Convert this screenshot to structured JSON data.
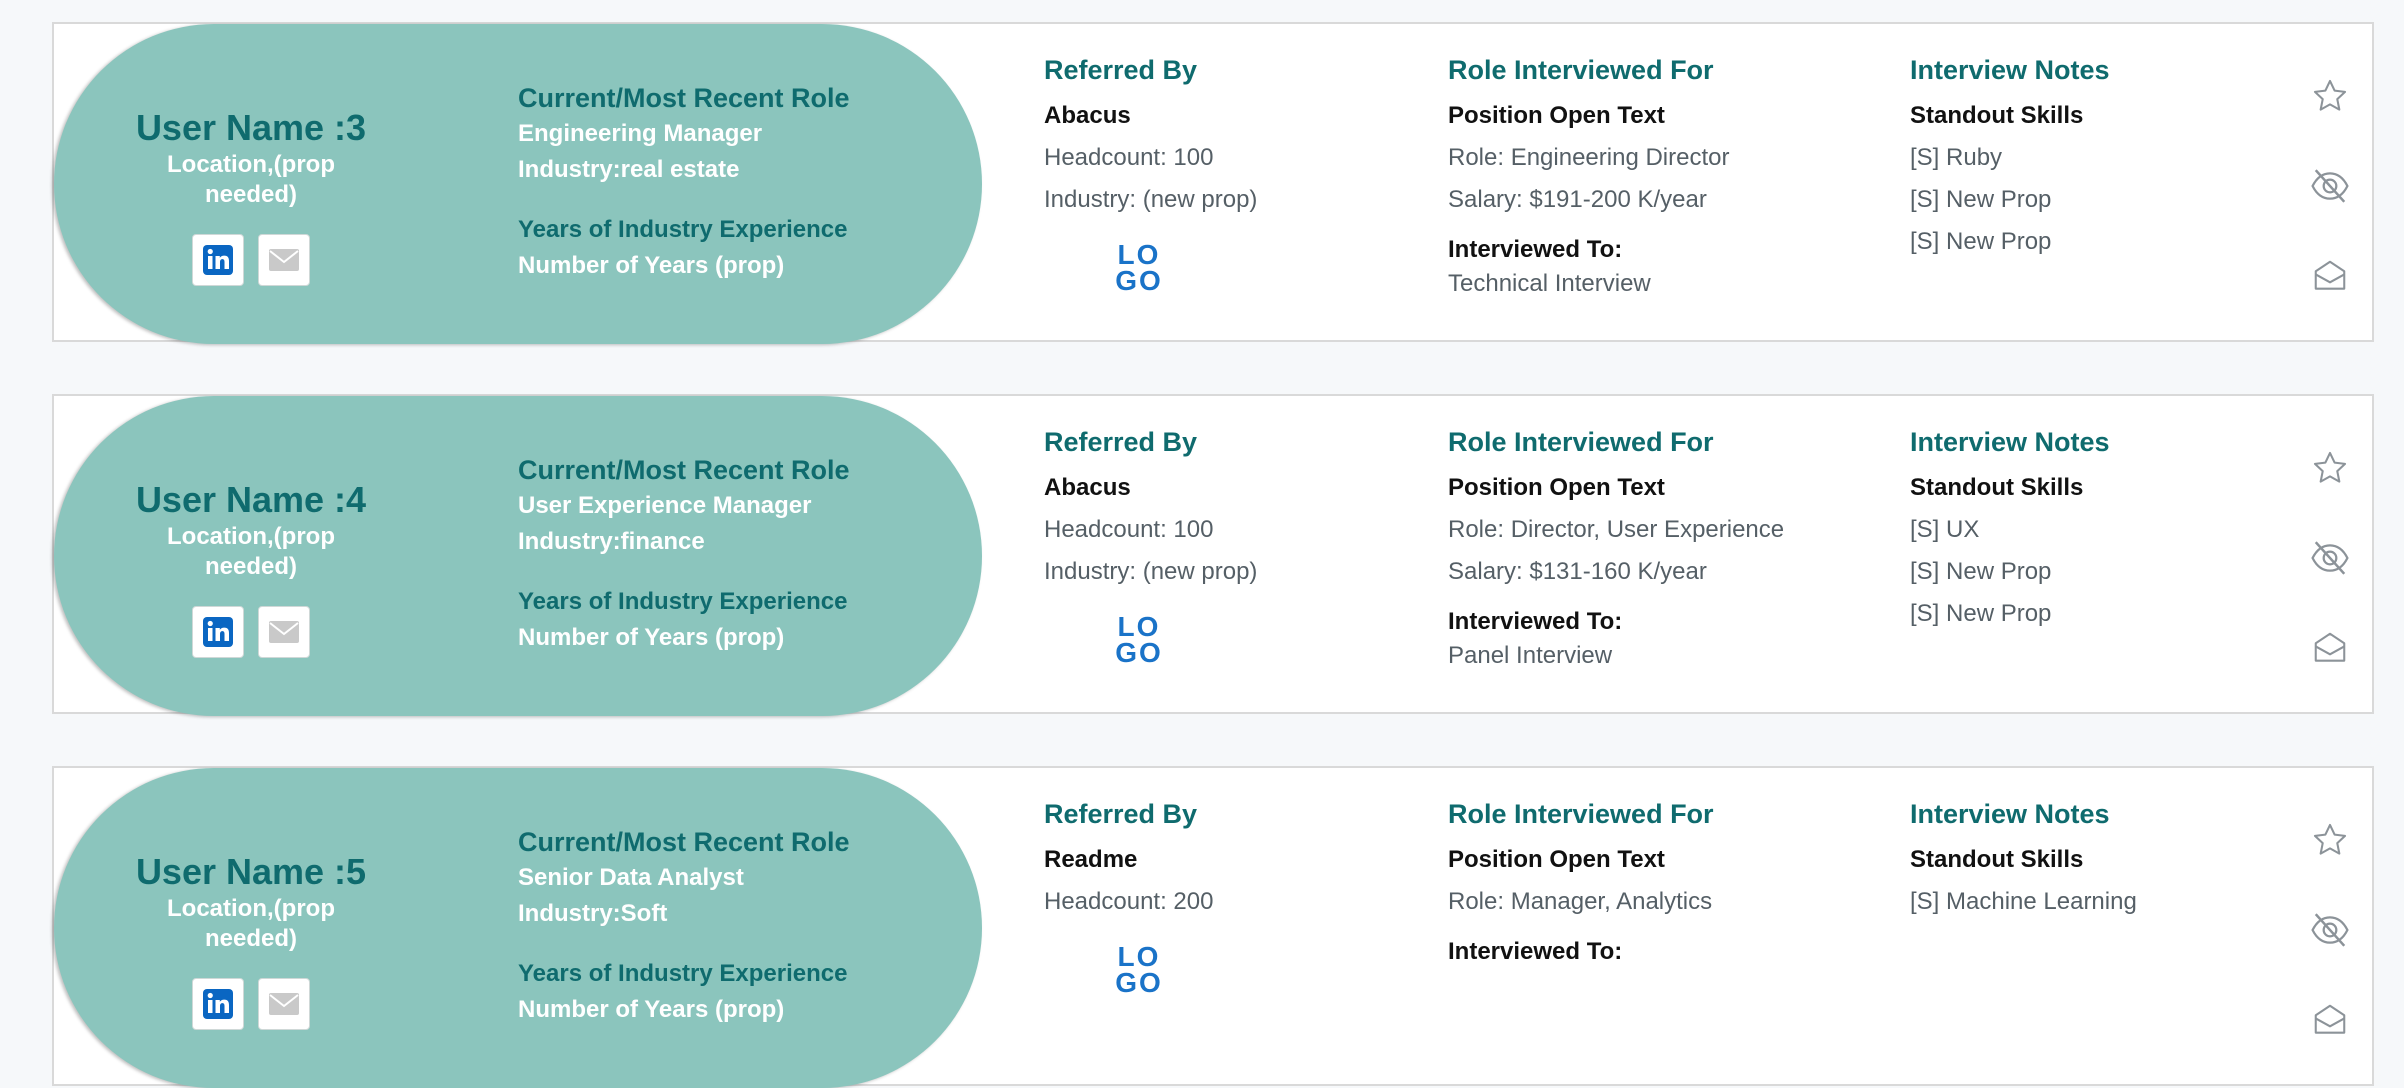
{
  "labels": {
    "current_role": "Current/Most Recent Role",
    "years_heading": "Years of Industry Experience",
    "years_value": "Number of Years (prop)",
    "referred_by": "Referred By",
    "role_interviewed_for": "Role Interviewed For",
    "interviewed_to": "Interviewed To:",
    "interview_notes": "Interview Notes",
    "standout_skills": "Standout Skills",
    "location": "Location,(prop needed)",
    "logo_text_top": "LO",
    "logo_text_bottom": "GO"
  },
  "icons": {
    "linkedin": "linkedin-icon",
    "email": "mail-icon",
    "favorite": "star-icon",
    "hide": "eye-off-icon",
    "archive": "inbox-icon"
  },
  "colors": {
    "accent_teal": "#0f6b6e",
    "pill_bg": "#8bc5bd",
    "logo_blue": "#1a73c8",
    "linkedin_blue": "#0a66c2"
  },
  "candidates": [
    {
      "user_name": "User Name :3",
      "title": "Engineering Manager",
      "industry": "Industry:real estate",
      "referrer": "Abacus",
      "headcount": "Headcount: 100",
      "ref_industry": "Industry: (new prop)",
      "position": "Position Open Text",
      "role": "Role: Engineering Director",
      "salary": "Salary: $191-200 K/year",
      "interview_type": "Technical Interview",
      "skills": [
        "[S] Ruby",
        "[S] New Prop",
        "[S] New Prop"
      ]
    },
    {
      "user_name": "User Name :4",
      "title": "User Experience Manager",
      "industry": "Industry:finance",
      "referrer": "Abacus",
      "headcount": "Headcount: 100",
      "ref_industry": "Industry: (new prop)",
      "position": "Position Open Text",
      "role": "Role: Director, User Experience",
      "salary": "Salary: $131-160 K/year",
      "interview_type": "Panel Interview",
      "skills": [
        "[S] UX",
        "[S] New Prop",
        "[S] New Prop"
      ]
    },
    {
      "user_name": "User Name :5",
      "title": "Senior Data Analyst",
      "industry": "Industry:Soft",
      "referrer": "Readme",
      "headcount": "Headcount: 200",
      "ref_industry": "",
      "position": "Position Open Text",
      "role": "Role: Manager, Analytics",
      "salary": "",
      "interview_type": "",
      "skills": [
        "[S] Machine Learning",
        "",
        ""
      ]
    }
  ]
}
